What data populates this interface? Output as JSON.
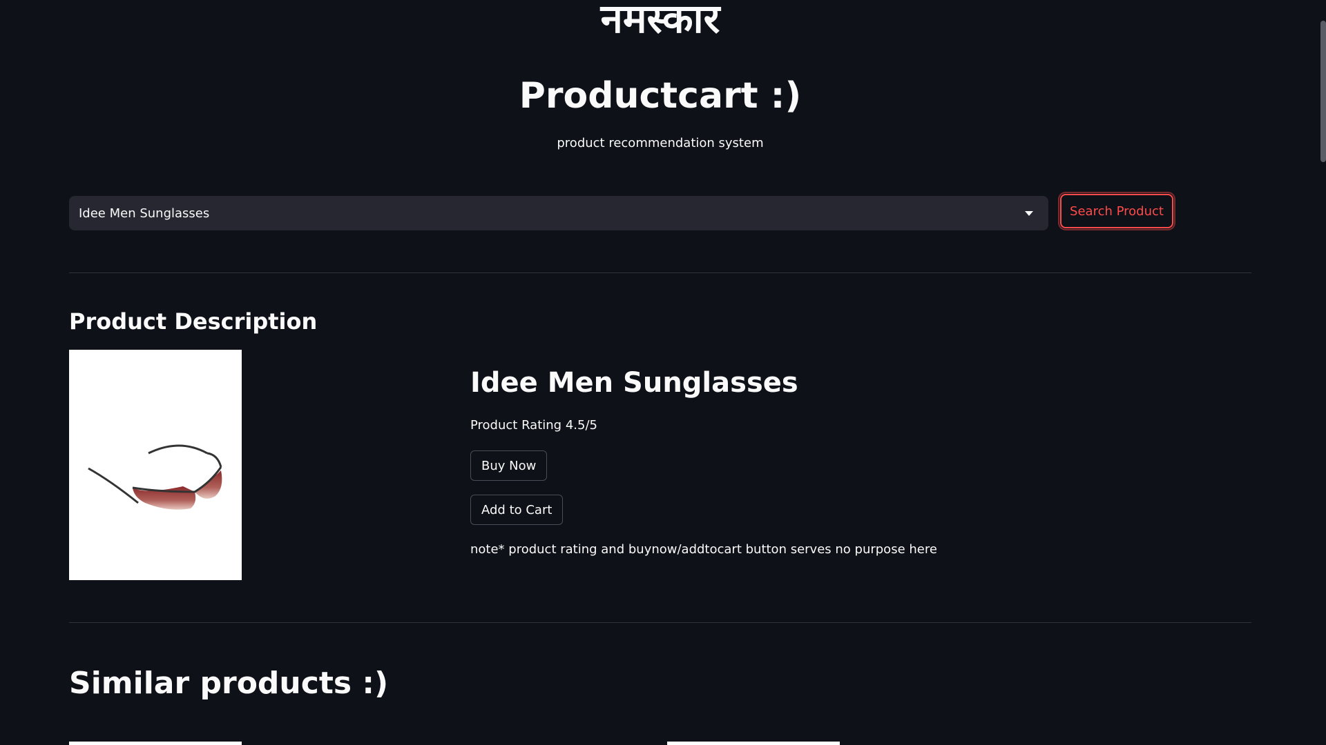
{
  "header": {
    "greeting": "नमस्कार",
    "title": "Productcart :)",
    "subtitle": "product recommendation system"
  },
  "search": {
    "selected_product": "Idee Men Sunglasses",
    "button_label": "Search Product"
  },
  "description_section": {
    "heading": "Product Description",
    "product_name": "Idee Men Sunglasses",
    "rating": "Product Rating 4.5/5",
    "buy_label": "Buy Now",
    "cart_label": "Add to Cart",
    "note": "note* product rating and buynow/addtocart button serves no purpose here"
  },
  "similar_section": {
    "heading": "Similar products :)"
  },
  "colors": {
    "background": "#0e1117",
    "accent": "#ff4b4b",
    "input_bg": "#262730",
    "text": "#fafafa"
  }
}
